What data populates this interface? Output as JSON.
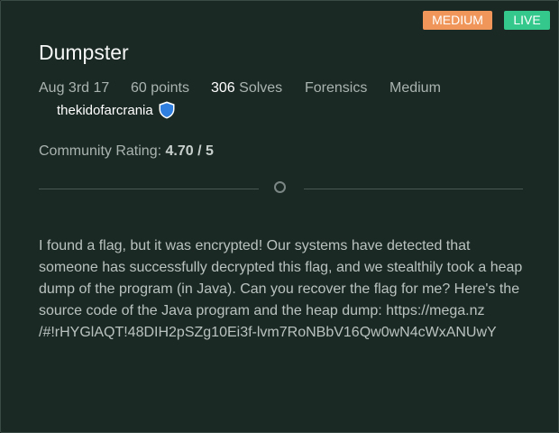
{
  "challenge": {
    "difficulty_badge": "MEDIUM",
    "status_badge": "LIVE",
    "title": "Dumpster",
    "date": "Aug 3rd 17",
    "points": "60 points",
    "solves_count": "306",
    "solves_label": "Solves",
    "category": "Forensics",
    "difficulty": "Medium",
    "author": "thekidofarcrania",
    "author_badge_icon": "shield-icon",
    "rating_label": "Community Rating:",
    "rating_value": "4.70 / 5",
    "description": "I found a flag, but it was encrypted! Our systems have detected that someone has successfully decrypted this flag, and we stealthily took a heap dump of the program (in Java). Can you recover the flag for me? Here's the source code of the Java program and the heap dump: https://mega.nz /#!rHYGlAQT!48DIH2pSZg10Ei3f-lvm7RoNBbV16Qw0wN4cWxANUwY"
  },
  "colors": {
    "background": "#1b2925",
    "medium_badge": "#f0965a",
    "live_badge": "#35c88c",
    "shield": "#2f7fe0"
  }
}
